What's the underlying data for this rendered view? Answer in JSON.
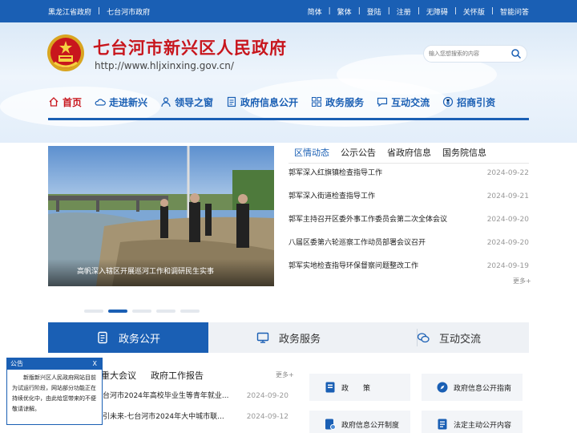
{
  "topbar": {
    "links_left": [
      "黑龙江省政府",
      "七台河市政府"
    ],
    "links_right": [
      "简体",
      "繁体",
      "登陆",
      "注册",
      "无障碍",
      "关怀版",
      "智能问答"
    ]
  },
  "header": {
    "title": "七台河市新兴区人民政府",
    "url": "http://www.hljxinxing.gov.cn/",
    "search_placeholder": "输入您想搜索的内容"
  },
  "nav": [
    {
      "label": "首页",
      "icon": "home-icon"
    },
    {
      "label": "走进新兴",
      "icon": "cloud-icon"
    },
    {
      "label": "领导之窗",
      "icon": "user-icon"
    },
    {
      "label": "政府信息公开",
      "icon": "document-icon"
    },
    {
      "label": "政务服务",
      "icon": "grid-icon"
    },
    {
      "label": "互动交流",
      "icon": "chat-icon"
    },
    {
      "label": "招商引资",
      "icon": "money-icon"
    }
  ],
  "slide": {
    "caption": "高帆深入辖区开展巡河工作和调研民生实事"
  },
  "news": {
    "tabs": [
      "区情动态",
      "公示公告",
      "省政府信息",
      "国务院信息"
    ],
    "items": [
      {
        "title": "郭军深入红旗镇检查指导工作",
        "date": "2024-09-22"
      },
      {
        "title": "郭军深入街道检查指导工作",
        "date": "2024-09-21"
      },
      {
        "title": "郭军主持召开区委外事工作委员会第二次全体会议",
        "date": "2024-09-20"
      },
      {
        "title": "八届区委第六轮巡察工作动员部署会议召开",
        "date": "2024-09-20"
      },
      {
        "title": "郭军实地检查指导环保督察问题整改工作",
        "date": "2024-09-19"
      }
    ],
    "more": "更多+"
  },
  "services": [
    {
      "label": "政务公开",
      "icon": "doc-list-icon"
    },
    {
      "label": "政务服务",
      "icon": "monitor-icon"
    },
    {
      "label": "互动交流",
      "icon": "chat-bubbles-icon"
    }
  ],
  "bottom": {
    "tabs": [
      "重大会议",
      "政府工作报告"
    ],
    "more": "更多+",
    "items": [
      {
        "title": "台河市2024年高校毕业生等青年就业...",
        "date": "2024-09-20"
      },
      {
        "title": "引未来-七台河市2024年大中城市联...",
        "date": "2024-09-12"
      }
    ]
  },
  "quick_links": [
    {
      "label": "政　　策",
      "icon": "book-icon"
    },
    {
      "label": "政府信息公开指南",
      "icon": "compass-icon"
    },
    {
      "label": "政府信息公开制度",
      "icon": "stamp-doc-icon"
    },
    {
      "label": "法定主动公开内容",
      "icon": "list-doc-icon"
    }
  ],
  "notice": {
    "title": "公告",
    "close": "X",
    "body": "新版新兴区人民政府网站目前为试运行阶段，网站部分功能正在持续优化中，由此给您带来的不便敬请谅解。"
  },
  "colors": {
    "brand_blue": "#1a5fb4",
    "title_red": "#c8161d"
  }
}
